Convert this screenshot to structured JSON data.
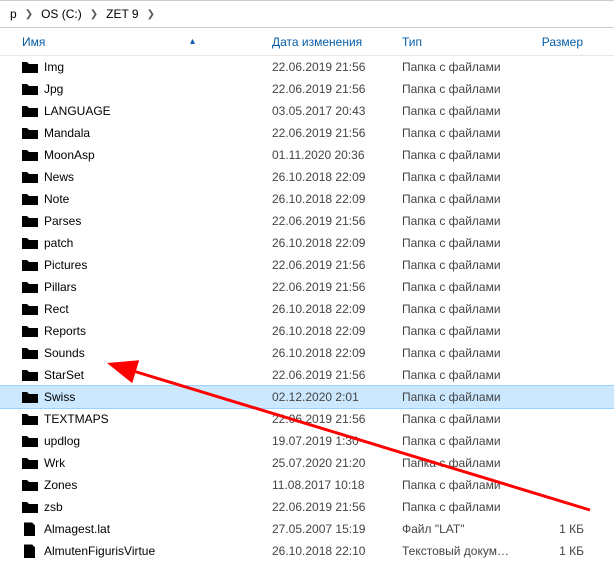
{
  "breadcrumb": {
    "segments": [
      "р",
      "OS (C:)",
      "ZET 9"
    ]
  },
  "columns": {
    "name": "Имя",
    "date": "Дата изменения",
    "type": "Тип",
    "size": "Размер"
  },
  "type_folder": "Папка с файлами",
  "items": [
    {
      "icon": "folder",
      "name": "Img",
      "date": "22.06.2019 21:56",
      "type": "Папка с файлами",
      "size": ""
    },
    {
      "icon": "folder",
      "name": "Jpg",
      "date": "22.06.2019 21:56",
      "type": "Папка с файлами",
      "size": ""
    },
    {
      "icon": "folder",
      "name": "LANGUAGE",
      "date": "03.05.2017 20:43",
      "type": "Папка с файлами",
      "size": ""
    },
    {
      "icon": "folder",
      "name": "Mandala",
      "date": "22.06.2019 21:56",
      "type": "Папка с файлами",
      "size": ""
    },
    {
      "icon": "folder",
      "name": "MoonAsp",
      "date": "01.11.2020 20:36",
      "type": "Папка с файлами",
      "size": ""
    },
    {
      "icon": "folder",
      "name": "News",
      "date": "26.10.2018 22:09",
      "type": "Папка с файлами",
      "size": ""
    },
    {
      "icon": "folder",
      "name": "Note",
      "date": "26.10.2018 22:09",
      "type": "Папка с файлами",
      "size": ""
    },
    {
      "icon": "folder",
      "name": "Parses",
      "date": "22.06.2019 21:56",
      "type": "Папка с файлами",
      "size": ""
    },
    {
      "icon": "folder",
      "name": "patch",
      "date": "26.10.2018 22:09",
      "type": "Папка с файлами",
      "size": ""
    },
    {
      "icon": "folder",
      "name": "Pictures",
      "date": "22.06.2019 21:56",
      "type": "Папка с файлами",
      "size": ""
    },
    {
      "icon": "folder",
      "name": "Pillars",
      "date": "22.06.2019 21:56",
      "type": "Папка с файлами",
      "size": ""
    },
    {
      "icon": "folder",
      "name": "Rect",
      "date": "26.10.2018 22:09",
      "type": "Папка с файлами",
      "size": ""
    },
    {
      "icon": "folder",
      "name": "Reports",
      "date": "26.10.2018 22:09",
      "type": "Папка с файлами",
      "size": ""
    },
    {
      "icon": "folder",
      "name": "Sounds",
      "date": "26.10.2018 22:09",
      "type": "Папка с файлами",
      "size": ""
    },
    {
      "icon": "folder",
      "name": "StarSet",
      "date": "22.06.2019 21:56",
      "type": "Папка с файлами",
      "size": ""
    },
    {
      "icon": "folder",
      "name": "Swiss",
      "date": "02.12.2020 2:01",
      "type": "Папка с файлами",
      "size": "",
      "selected": true
    },
    {
      "icon": "folder",
      "name": "TEXTMAPS",
      "date": "22.06.2019 21:56",
      "type": "Папка с файлами",
      "size": ""
    },
    {
      "icon": "folder",
      "name": "updlog",
      "date": "19.07.2019 1:30",
      "type": "Папка с файлами",
      "size": ""
    },
    {
      "icon": "folder",
      "name": "Wrk",
      "date": "25.07.2020 21:20",
      "type": "Папка с файлами",
      "size": ""
    },
    {
      "icon": "folder",
      "name": "Zones",
      "date": "11.08.2017 10:18",
      "type": "Папка с файлами",
      "size": ""
    },
    {
      "icon": "folder",
      "name": "zsb",
      "date": "22.06.2019 21:56",
      "type": "Папка с файлами",
      "size": ""
    },
    {
      "icon": "file",
      "name": "Almagest.lat",
      "date": "27.05.2007 15:19",
      "type": "Файл \"LAT\"",
      "size": "1 КБ"
    },
    {
      "icon": "file",
      "name": "AlmutenFigurisVirtue",
      "date": "26.10.2018 22:10",
      "type": "Текстовый докум…",
      "size": "1 КБ"
    }
  ],
  "annotation": {
    "arrow_color": "#ff0000"
  }
}
